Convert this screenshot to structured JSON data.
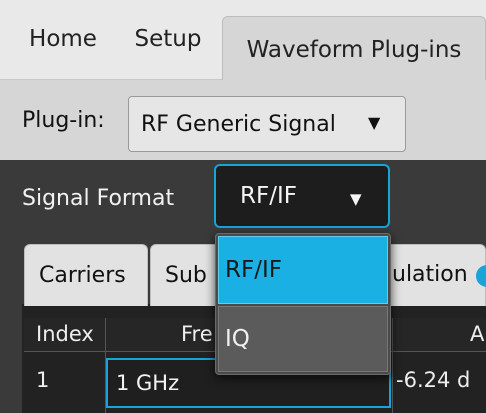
{
  "top_tabs": [
    "Home",
    "Setup",
    "Waveform Plug-ins"
  ],
  "plugin": {
    "label": "Plug-in:",
    "selected": "RF Generic Signal"
  },
  "signal_format": {
    "label": "Signal Format",
    "selected": "RF/IF",
    "options": [
      "RF/IF",
      "IQ"
    ]
  },
  "sub_tabs": {
    "carriers": "Carriers",
    "sub": "Sub",
    "modulation": "ulation"
  },
  "table": {
    "headers": {
      "index": "Index",
      "frequency": "Fre",
      "amplitude": "A"
    },
    "rows": [
      {
        "index": "1",
        "frequency": "1 GHz",
        "amplitude": "-6.24 d"
      }
    ]
  },
  "colors": {
    "accent": "#19a3d6",
    "selected_option": "#1bb0e3"
  }
}
